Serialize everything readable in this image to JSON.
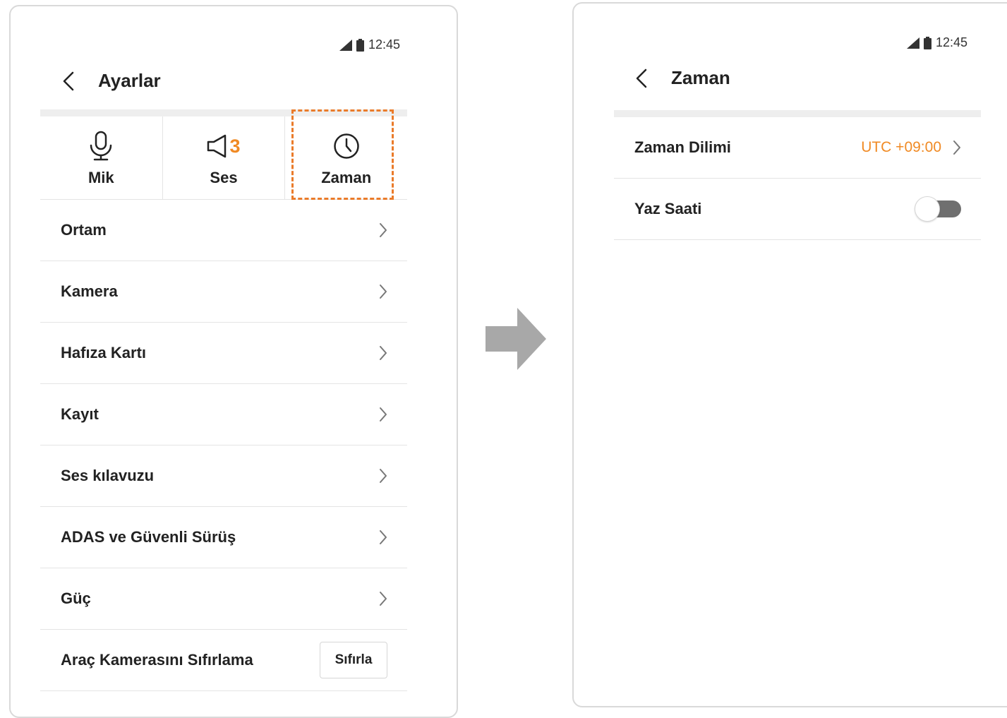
{
  "colors": {
    "accent": "#f08a24",
    "highlight_border": "#ea7b2a",
    "arrow": "#a8a8a8",
    "toggle_off": "#6f6f6f"
  },
  "left_screen": {
    "status": {
      "time": "12:45",
      "icons": [
        "signal-icon",
        "battery-icon"
      ]
    },
    "header": {
      "back_icon": "chevron-left-icon",
      "title": "Ayarlar"
    },
    "tabs": [
      {
        "label": "Mik",
        "icon": "microphone-icon"
      },
      {
        "label": "Ses",
        "icon": "speaker-icon",
        "badge": "3"
      },
      {
        "label": "Zaman",
        "icon": "clock-icon",
        "highlighted": true
      }
    ],
    "menu": [
      {
        "label": "Ortam"
      },
      {
        "label": "Kamera"
      },
      {
        "label": "Hafıza Kartı"
      },
      {
        "label": "Kayıt"
      },
      {
        "label": "Ses kılavuzu"
      },
      {
        "label": "ADAS ve Güvenli Sürüş"
      },
      {
        "label": "Güç"
      }
    ],
    "reset_row": {
      "label": "Araç Kamerasını Sıfırlama",
      "button": "Sıfırla"
    }
  },
  "transition_icon": "right-arrow-icon",
  "right_screen": {
    "status": {
      "time": "12:45",
      "icons": [
        "signal-icon",
        "battery-icon"
      ]
    },
    "header": {
      "back_icon": "chevron-left-icon",
      "title": "Zaman"
    },
    "rows": {
      "timezone": {
        "label": "Zaman Dilimi",
        "value": "UTC +09:00"
      },
      "dst": {
        "label": "Yaz Saati",
        "enabled": false
      }
    }
  }
}
